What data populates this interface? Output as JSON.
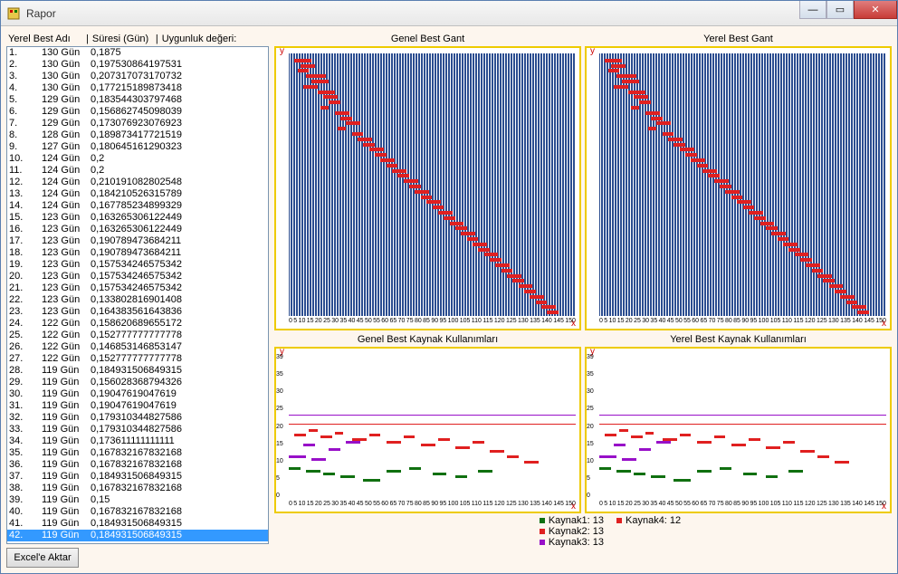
{
  "window": {
    "title": "Rapor"
  },
  "titlebar_buttons": {
    "min": "—",
    "max": "▭",
    "close": "✕"
  },
  "list_header": {
    "col1": "Yerel Best Adı",
    "sep": "|",
    "col2": "Süresi (Gün)",
    "col3": "Uygunluk değeri:"
  },
  "list_rows": [
    {
      "idx": "1.",
      "dur": "130 Gün",
      "val": "0,1875"
    },
    {
      "idx": "2.",
      "dur": "130 Gün",
      "val": "0,197530864197531"
    },
    {
      "idx": "3.",
      "dur": "130 Gün",
      "val": "0,207317073170732"
    },
    {
      "idx": "4.",
      "dur": "130 Gün",
      "val": "0,177215189873418"
    },
    {
      "idx": "5.",
      "dur": "129 Gün",
      "val": "0,183544303797468"
    },
    {
      "idx": "6.",
      "dur": "129 Gün",
      "val": "0,156862745098039"
    },
    {
      "idx": "7.",
      "dur": "129 Gün",
      "val": "0,173076923076923"
    },
    {
      "idx": "8.",
      "dur": "128 Gün",
      "val": "0,189873417721519"
    },
    {
      "idx": "9.",
      "dur": "127 Gün",
      "val": "0,180645161290323"
    },
    {
      "idx": "10.",
      "dur": "124 Gün",
      "val": "0,2"
    },
    {
      "idx": "11.",
      "dur": "124 Gün",
      "val": "0,2"
    },
    {
      "idx": "12.",
      "dur": "124 Gün",
      "val": "0,210191082802548"
    },
    {
      "idx": "13.",
      "dur": "124 Gün",
      "val": "0,184210526315789"
    },
    {
      "idx": "14.",
      "dur": "124 Gün",
      "val": "0,167785234899329"
    },
    {
      "idx": "15.",
      "dur": "123 Gün",
      "val": "0,163265306122449"
    },
    {
      "idx": "16.",
      "dur": "123 Gün",
      "val": "0,163265306122449"
    },
    {
      "idx": "17.",
      "dur": "123 Gün",
      "val": "0,190789473684211"
    },
    {
      "idx": "18.",
      "dur": "123 Gün",
      "val": "0,190789473684211"
    },
    {
      "idx": "19.",
      "dur": "123 Gün",
      "val": "0,157534246575342"
    },
    {
      "idx": "20.",
      "dur": "123 Gün",
      "val": "0,157534246575342"
    },
    {
      "idx": "21.",
      "dur": "123 Gün",
      "val": "0,157534246575342"
    },
    {
      "idx": "22.",
      "dur": "123 Gün",
      "val": "0,133802816901408"
    },
    {
      "idx": "23.",
      "dur": "123 Gün",
      "val": "0,164383561643836"
    },
    {
      "idx": "24.",
      "dur": "122 Gün",
      "val": "0,158620689655172"
    },
    {
      "idx": "25.",
      "dur": "122 Gün",
      "val": "0,152777777777778"
    },
    {
      "idx": "26.",
      "dur": "122 Gün",
      "val": "0,146853146853147"
    },
    {
      "idx": "27.",
      "dur": "122 Gün",
      "val": "0,152777777777778"
    },
    {
      "idx": "28.",
      "dur": "119 Gün",
      "val": "0,184931506849315"
    },
    {
      "idx": "29.",
      "dur": "119 Gün",
      "val": "0,156028368794326"
    },
    {
      "idx": "30.",
      "dur": "119 Gün",
      "val": "0,19047619047619"
    },
    {
      "idx": "31.",
      "dur": "119 Gün",
      "val": "0,19047619047619"
    },
    {
      "idx": "32.",
      "dur": "119 Gün",
      "val": "0,179310344827586"
    },
    {
      "idx": "33.",
      "dur": "119 Gün",
      "val": "0,179310344827586"
    },
    {
      "idx": "34.",
      "dur": "119 Gün",
      "val": "0,173611111111111"
    },
    {
      "idx": "35.",
      "dur": "119 Gün",
      "val": "0,167832167832168"
    },
    {
      "idx": "36.",
      "dur": "119 Gün",
      "val": "0,167832167832168"
    },
    {
      "idx": "37.",
      "dur": "119 Gün",
      "val": "0,184931506849315"
    },
    {
      "idx": "38.",
      "dur": "119 Gün",
      "val": "0,167832167832168"
    },
    {
      "idx": "39.",
      "dur": "119 Gün",
      "val": "0,15"
    },
    {
      "idx": "40.",
      "dur": "119 Gün",
      "val": "0,167832167832168"
    },
    {
      "idx": "41.",
      "dur": "119 Gün",
      "val": "0,184931506849315"
    },
    {
      "idx": "42.",
      "dur": "119 Gün",
      "val": "0,184931506849315",
      "selected": true
    }
  ],
  "excel_btn": "Excel'e Aktar",
  "charts": {
    "genel_gant": "Genel Best Gant",
    "yerel_gant": "Yerel Best Gant",
    "genel_kaynak": "Genel Best Kaynak Kullanımları",
    "yerel_kaynak": "Yerel Best Kaynak Kullanımları",
    "y_label": "y",
    "x_label": "x"
  },
  "legend": {
    "k1": "Kaynak1: 13",
    "k2": "Kaynak2: 13",
    "k3": "Kaynak3: 13",
    "k4": "Kaynak4: 12"
  },
  "legend_colors": {
    "k1": "#107010",
    "k2": "#e02020",
    "k3": "#9810c8",
    "k4": "#e02020"
  },
  "chart_data": [
    {
      "type": "bar",
      "title": "Genel Best Gant",
      "xlim": [
        0,
        150
      ],
      "note": "Gantt: each red bar = activity start/duration (approx)",
      "bars_pct": [
        [
          2,
          6,
          98
        ],
        [
          4,
          5,
          96
        ],
        [
          3,
          4,
          94
        ],
        [
          6,
          7,
          92
        ],
        [
          8,
          6,
          90
        ],
        [
          5,
          5,
          88
        ],
        [
          10,
          6,
          86
        ],
        [
          12,
          5,
          84
        ],
        [
          14,
          4,
          82
        ],
        [
          11,
          3,
          80
        ],
        [
          16,
          5,
          78
        ],
        [
          18,
          4,
          76
        ],
        [
          20,
          5,
          74
        ],
        [
          17,
          3,
          72
        ],
        [
          22,
          4,
          70
        ],
        [
          24,
          5,
          68
        ],
        [
          26,
          4,
          66
        ],
        [
          28,
          5,
          64
        ],
        [
          30,
          4,
          62
        ],
        [
          32,
          5,
          60
        ],
        [
          34,
          4,
          58
        ],
        [
          36,
          5,
          56
        ],
        [
          38,
          4,
          54
        ],
        [
          40,
          5,
          52
        ],
        [
          42,
          4,
          50
        ],
        [
          44,
          5,
          48
        ],
        [
          46,
          4,
          46
        ],
        [
          48,
          5,
          44
        ],
        [
          50,
          4,
          42
        ],
        [
          52,
          5,
          40
        ],
        [
          54,
          4,
          38
        ],
        [
          56,
          5,
          36
        ],
        [
          58,
          4,
          34
        ],
        [
          60,
          5,
          32
        ],
        [
          62,
          4,
          30
        ],
        [
          64,
          5,
          28
        ],
        [
          66,
          4,
          26
        ],
        [
          68,
          5,
          24
        ],
        [
          70,
          4,
          22
        ],
        [
          72,
          5,
          20
        ],
        [
          74,
          4,
          18
        ],
        [
          76,
          5,
          16
        ],
        [
          78,
          4,
          14
        ],
        [
          80,
          5,
          12
        ],
        [
          82,
          4,
          10
        ],
        [
          84,
          5,
          8
        ],
        [
          86,
          4,
          6
        ],
        [
          88,
          5,
          4
        ],
        [
          90,
          4,
          2
        ]
      ]
    },
    {
      "type": "bar",
      "title": "Yerel Best Gant",
      "xlim": [
        0,
        150
      ],
      "same_as": "Genel Best Gant"
    },
    {
      "type": "bar",
      "title": "Genel Best Kaynak Kullanımları",
      "xlim": [
        0,
        150
      ],
      "ylim": [
        0,
        39
      ],
      "limit_lines": [
        {
          "y_pct": 42,
          "color": "#9810c8"
        },
        {
          "y_pct": 48,
          "color": "#e02020"
        }
      ],
      "segments_pct": [
        [
          0,
          6,
          70,
          "r3"
        ],
        [
          5,
          4,
          62,
          "r3"
        ],
        [
          8,
          5,
          72,
          "r3"
        ],
        [
          14,
          4,
          65,
          "r3"
        ],
        [
          20,
          5,
          60,
          "r3"
        ],
        [
          0,
          4,
          78,
          "r1"
        ],
        [
          6,
          5,
          80,
          "r1"
        ],
        [
          12,
          4,
          82,
          "r1"
        ],
        [
          18,
          5,
          84,
          "r1"
        ],
        [
          26,
          6,
          86,
          "r1"
        ],
        [
          34,
          5,
          80,
          "r1"
        ],
        [
          42,
          4,
          78,
          "r1"
        ],
        [
          50,
          5,
          82,
          "r1"
        ],
        [
          58,
          4,
          84,
          "r1"
        ],
        [
          66,
          5,
          80,
          "r1"
        ],
        [
          2,
          4,
          55,
          "r2"
        ],
        [
          7,
          3,
          52,
          "r2"
        ],
        [
          11,
          4,
          56,
          "r2"
        ],
        [
          16,
          3,
          54,
          "r2"
        ],
        [
          22,
          5,
          58,
          "r2"
        ],
        [
          28,
          4,
          55,
          "r2"
        ],
        [
          34,
          5,
          60,
          "r2"
        ],
        [
          40,
          4,
          56,
          "r2"
        ],
        [
          46,
          5,
          62,
          "r2"
        ],
        [
          52,
          4,
          58,
          "r2"
        ],
        [
          58,
          5,
          64,
          "r2"
        ],
        [
          64,
          4,
          60,
          "r2"
        ],
        [
          70,
          5,
          66,
          "r2"
        ],
        [
          76,
          4,
          70,
          "r2"
        ],
        [
          82,
          5,
          74,
          "r2"
        ]
      ]
    },
    {
      "type": "bar",
      "title": "Yerel Best Kaynak Kullanımları",
      "xlim": [
        0,
        150
      ],
      "ylim": [
        0,
        39
      ],
      "same_as": "Genel Best Kaynak Kullanımları"
    }
  ],
  "x_tick_values": [
    0,
    5,
    10,
    15,
    20,
    25,
    30,
    35,
    40,
    45,
    50,
    55,
    60,
    65,
    70,
    75,
    80,
    85,
    90,
    95,
    100,
    105,
    110,
    115,
    120,
    125,
    130,
    135,
    140,
    145,
    150
  ],
  "y_tick_values_resource": [
    0,
    5,
    10,
    15,
    20,
    25,
    30,
    35,
    39
  ]
}
